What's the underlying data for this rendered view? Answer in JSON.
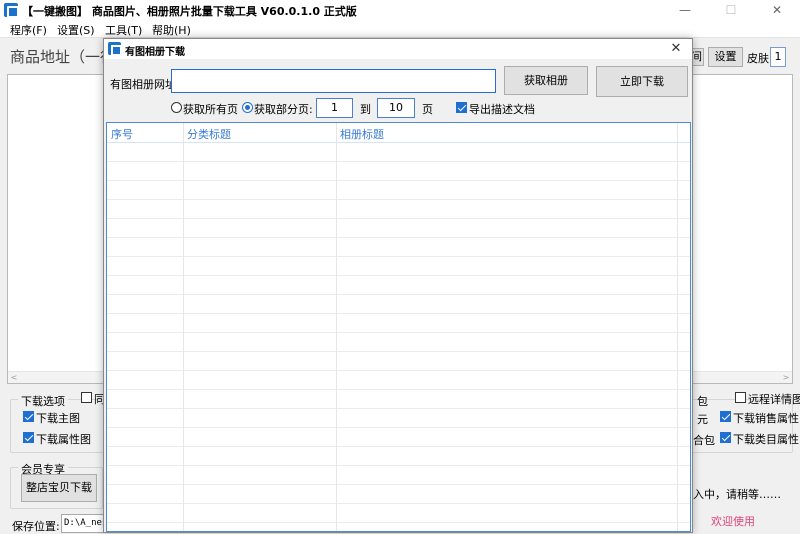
{
  "app": {
    "title": "【一键搬图】 商品图片、相册照片批量下载工具 V60.0.1.0 正式版",
    "window_controls": {
      "minimize": "—",
      "maximize": "☐",
      "close": "✕"
    }
  },
  "menu": [
    "程序(F)",
    "设置(S)",
    "工具(T)",
    "帮助(H)"
  ],
  "main": {
    "url_label": "商品地址（一行",
    "partial_button": "间",
    "settings_button": "设置",
    "skin_label": "皮肤:",
    "skin_value": "1",
    "scroll_left": "<",
    "scroll_right": ">"
  },
  "download_options": {
    "group_title": "下载选项",
    "main_image": {
      "label": "下载主图",
      "checked": true
    },
    "attr_image": {
      "label": "下载属性图",
      "checked": true
    },
    "partial_same": {
      "label": "同",
      "checked": false
    },
    "right_pkg": "包",
    "remote_detail": {
      "label": "远程详情图",
      "checked": false
    },
    "right_yuan": "元",
    "sales_attr": {
      "label": "下载销售属性",
      "checked": true
    },
    "right_pkg2": "合包",
    "category_attr": {
      "label": "下载类目属性",
      "checked": true
    }
  },
  "member": {
    "group_title": "会员专享",
    "shop_button": "整店宝贝下载"
  },
  "status": {
    "loading": "入中，请稍等……",
    "welcome": "欢迎使用"
  },
  "save": {
    "label": "保存位置:",
    "path": "D:\\A_neso"
  },
  "dialog": {
    "title": "有图相册下载",
    "close": "✕",
    "url_label": "有图相册网址:",
    "url_value": "",
    "fetch_button": "获取相册",
    "download_button": "立即下载",
    "radio_all": {
      "label": "获取所有页",
      "checked": false
    },
    "radio_partial": {
      "label": "获取部分页:",
      "checked": true
    },
    "page_from": "1",
    "page_to_label": "到",
    "page_to": "10",
    "page_unit": "页",
    "export_desc": {
      "label": "导出描述文档",
      "checked": true
    },
    "columns": [
      "序号",
      "分类标题",
      "相册标题"
    ]
  },
  "colors": {
    "accent": "#1f6fd1",
    "grid_header_text": "#3a7bd5",
    "welcome": "#e0457b"
  }
}
